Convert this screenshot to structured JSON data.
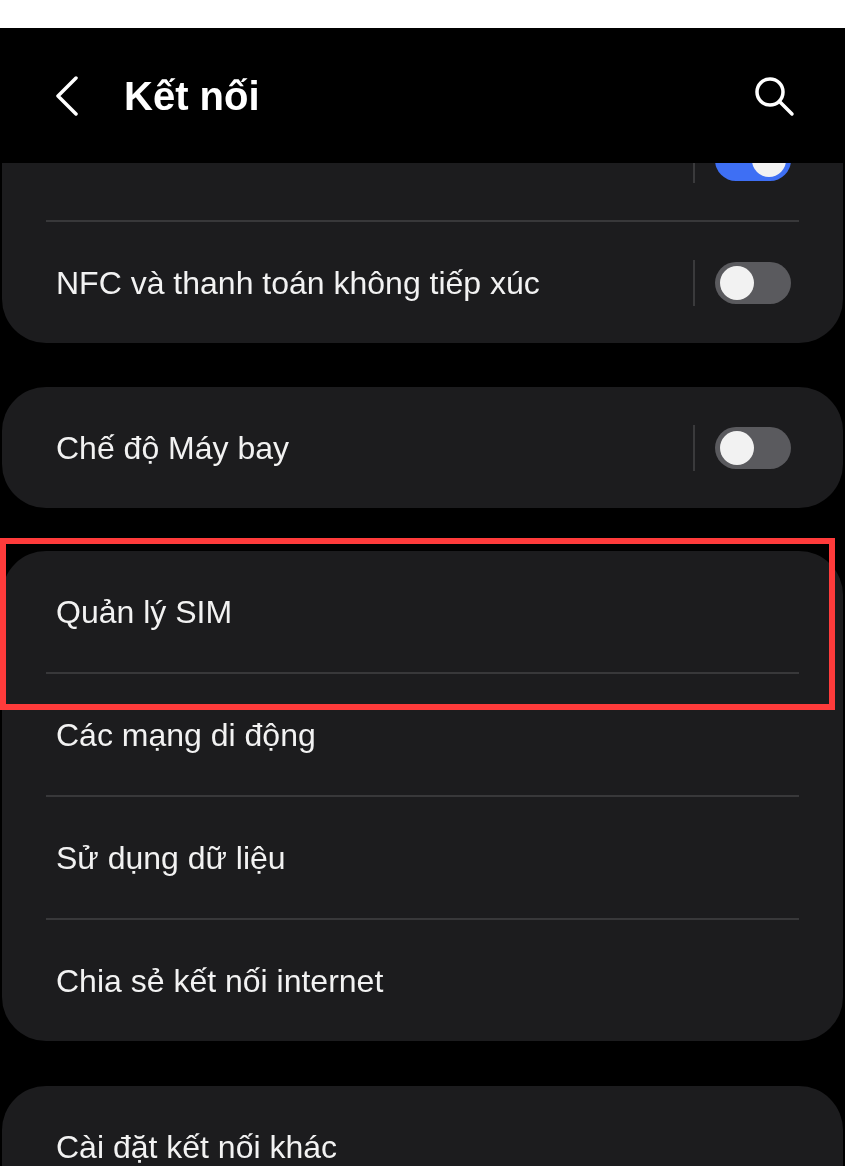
{
  "header": {
    "title": "Kết nối"
  },
  "groups": [
    {
      "items": [
        {
          "kind": "toggle",
          "on": true,
          "highlighted": false
        },
        {
          "kind": "toggle",
          "label": "NFC và thanh toán không tiếp xúc",
          "on": false,
          "highlighted": false
        }
      ]
    },
    {
      "items": [
        {
          "kind": "toggle",
          "label": "Chế độ Máy bay",
          "on": false,
          "highlighted": false
        }
      ]
    },
    {
      "items": [
        {
          "kind": "link",
          "label": "Quản lý SIM",
          "highlighted": true
        },
        {
          "kind": "link",
          "label": "Các mạng di động",
          "highlighted": false
        },
        {
          "kind": "link",
          "label": "Sử dụng dữ liệu",
          "highlighted": false
        },
        {
          "kind": "link",
          "label": "Chia sẻ kết nối internet",
          "highlighted": false
        }
      ]
    },
    {
      "items": [
        {
          "kind": "link",
          "label": "Cài đặt kết nối khác",
          "highlighted": false
        }
      ]
    }
  ]
}
